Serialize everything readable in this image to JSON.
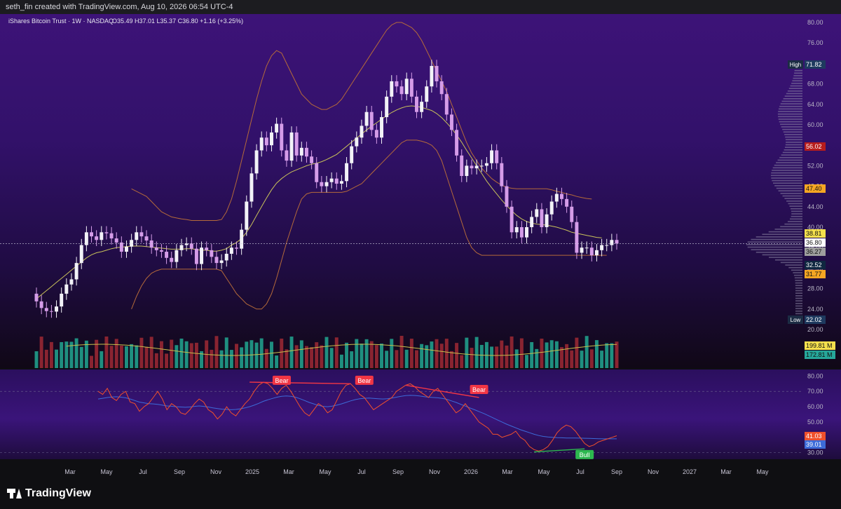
{
  "header": {
    "credit": "seth_fin created with TradingView.com, Aug 10, 2026 06:54 UTC-4"
  },
  "legend": {
    "symbol": "iShares Bitcoin Trust · 1W · NASDAQ",
    "ohlc": "O35.49  H37.01  L35.37  C36.80  +1.16 (+3.25%)"
  },
  "footer": {
    "brand": "TradingView"
  },
  "colors": {
    "bull_candle": "#f2f2f7",
    "bear_candle": "#d59ce8",
    "bb_band": "#b56a3a",
    "bb_basis": "#c9c25a",
    "vol_up": "#1f8f80",
    "vol_down": "#8a2431",
    "vol_ma": "#c8bf4c",
    "rsi_line": "#f0502c",
    "rsi_ma": "#3d6bd9",
    "bear_label": "#f23645",
    "bull_label": "#2db84f"
  },
  "chart_data": [
    {
      "type": "candlestick",
      "title": "iShares Bitcoin Trust · 1W · NASDAQ",
      "ylim": [
        20,
        82
      ],
      "y_ticks": [
        "80.00",
        "76.00",
        "72.00",
        "68.00",
        "64.00",
        "60.00",
        "56.00",
        "52.00",
        "48.00",
        "44.00",
        "40.00",
        "36.00",
        "32.00",
        "28.00",
        "24.00",
        "20.00"
      ],
      "x_ticks": [
        "Mar",
        "May",
        "Jul",
        "Sep",
        "Nov",
        "2025",
        "Mar",
        "May",
        "Jul",
        "Sep",
        "Nov",
        "2026",
        "Mar",
        "May",
        "Jul",
        "Sep",
        "Nov",
        "2027",
        "Mar",
        "May"
      ],
      "candle_closes": [
        25.5,
        24.2,
        23.6,
        23.5,
        24.5,
        27,
        28.8,
        29.8,
        33,
        36.5,
        39,
        38.2,
        37.5,
        39,
        38.8,
        37.8,
        37,
        35.2,
        36.2,
        37.5,
        39,
        38.2,
        37.4,
        36,
        35.5,
        35.2,
        34,
        33.2,
        35.5,
        36.5,
        36.8,
        35.8,
        32.8,
        36,
        35.5,
        34.2,
        33,
        33.5,
        34.8,
        36,
        35.8,
        39.5,
        45,
        50.5,
        55,
        57.5,
        56,
        58.5,
        60.2,
        55,
        53,
        58.5,
        54,
        55.5,
        53.8,
        52.5,
        48.8,
        48,
        48.8,
        49.5,
        48.5,
        49,
        52.5,
        55.8,
        57.5,
        59.8,
        62.5,
        59,
        57.5,
        61.5,
        65.5,
        68.5,
        67.5,
        66,
        69,
        65.5,
        62.5,
        64.5,
        67.5,
        71.5,
        68.5,
        66,
        62,
        59,
        54,
        50,
        52,
        51.5,
        52,
        52,
        52.5,
        55,
        52.5,
        48,
        44,
        39,
        40,
        38,
        40,
        42,
        43.5,
        40,
        42.5,
        45,
        46.5,
        45.5,
        44,
        41,
        35,
        36,
        36,
        34.5,
        35.5,
        36.5,
        36.5,
        37.5,
        36.8
      ],
      "bb_basis": [
        26,
        26.8,
        27.6,
        28.4,
        29.2,
        30,
        30.8,
        31.6,
        32.4,
        33.2,
        34,
        34.6,
        35,
        35.2,
        35.5,
        35.8,
        36,
        36.1,
        36.2,
        36.3,
        36.3,
        36.3,
        36.2,
        36.1,
        36,
        35.9,
        35.8,
        35.7,
        35.7,
        35.7,
        35.8,
        35.8,
        35.6,
        35.5,
        35.5,
        35.3,
        35.3,
        35.5,
        35.8,
        36.5,
        37,
        37.8,
        39,
        40.5,
        42.3,
        44,
        45.7,
        47.3,
        48.6,
        49.5,
        50.2,
        50.8,
        51.2,
        51.6,
        52,
        52.3,
        52.5,
        52.8,
        53.2,
        53.7,
        54.2,
        55,
        55.8,
        56.6,
        57.4,
        58.2,
        59,
        59.7,
        60.4,
        61.1,
        61.8,
        62.4,
        62.9,
        63.3,
        63.6,
        63.7,
        63.6,
        63.4,
        63.1,
        62.8,
        62.2,
        61.4,
        60.4,
        59.3,
        58,
        56.6,
        55,
        53.5,
        52,
        50.5,
        49,
        47.7,
        46.5,
        45.3,
        44.2,
        43.2,
        42.3,
        41.6,
        41.1,
        40.8,
        40.6,
        40.5,
        40.4,
        40.2,
        40,
        39.7,
        39.4,
        39,
        38.8,
        38.6,
        38.4,
        38.2,
        38,
        37.9
      ],
      "bb_upper": [
        0,
        0,
        0,
        0,
        0,
        0,
        0,
        0,
        0,
        0,
        0,
        0,
        0,
        0,
        0,
        0,
        0,
        0,
        0,
        47.5,
        47,
        46.5,
        46,
        45,
        44,
        43,
        42.5,
        42,
        41.8,
        41.6,
        41.5,
        41.3,
        41.3,
        41.3,
        41.3,
        41.3,
        41.3,
        41.5,
        43,
        45.5,
        49,
        53,
        57,
        61,
        65,
        68.5,
        71.5,
        73.5,
        74.5,
        74,
        72,
        70,
        68,
        66,
        65,
        64,
        63.5,
        63,
        63,
        63.5,
        64,
        65,
        66.5,
        68,
        69.5,
        71,
        72.5,
        74,
        75.5,
        77,
        78.5,
        79.5,
        80,
        80,
        79.5,
        79,
        78,
        76.5,
        74.5,
        72.5,
        70.5,
        68.5,
        66.5,
        64,
        61.5,
        59,
        56.5,
        54.5,
        53,
        51.5,
        50.5,
        49.5,
        48.8,
        48.2,
        47.8,
        47.6,
        47.5,
        47.5,
        47.5,
        47.5,
        47.5,
        47.5,
        47.5,
        47.3,
        47,
        46.8,
        46.5,
        46.3,
        46,
        45.8,
        45.6,
        45.5
      ],
      "bb_lower": [
        0,
        0,
        0,
        0,
        0,
        0,
        0,
        0,
        0,
        0,
        0,
        0,
        0,
        0,
        0,
        0,
        0,
        0,
        0,
        24,
        26.5,
        28.5,
        30,
        31,
        31.5,
        31.8,
        31.8,
        31.8,
        31.8,
        31.8,
        31.8,
        31.8,
        31.8,
        31.8,
        31.8,
        31.8,
        31.8,
        31.5,
        30,
        28.5,
        27,
        26,
        25,
        24.5,
        24,
        24,
        25,
        27,
        30,
        33.5,
        37,
        40,
        43,
        45.5,
        46.5,
        46.8,
        46.8,
        46.8,
        46.8,
        46.8,
        46.8,
        46.8,
        47,
        47.5,
        48,
        48.5,
        49.5,
        50.5,
        51.5,
        52.5,
        53.5,
        54.5,
        55.5,
        56.5,
        57,
        57,
        57,
        56.8,
        56.5,
        56,
        55,
        53,
        50,
        47,
        44,
        41,
        38,
        36,
        35,
        34.5,
        34.5,
        34.5,
        34.5,
        34.5,
        34.5,
        34.5,
        34.5,
        34.5,
        34.5,
        34.5,
        34.5,
        34.5,
        34.5,
        34.5,
        34.5,
        34.5,
        34.5,
        34.5,
        34.5,
        34.5,
        34.5,
        34.5,
        34.5,
        34.5,
        34.5
      ],
      "volume_trend": "volume bars, green up / red down, with yellow moving average",
      "axis_price_labels": [
        {
          "label": "High",
          "value": "71.82",
          "color": "#1e3a5f"
        },
        {
          "label": "",
          "value": "56.02",
          "color": "#b71c1c"
        },
        {
          "label": "",
          "value": "47.40",
          "color": "#f5a623"
        },
        {
          "label": "",
          "value": "38.81",
          "color": "#f4e04d"
        },
        {
          "label": "",
          "value": "36.80",
          "color": "#ffffff"
        },
        {
          "label": "",
          "value": "36.27",
          "color": "#9e9e9e"
        },
        {
          "label": "",
          "value": "32.52",
          "color": "#0f2740"
        },
        {
          "label": "",
          "value": "31.77",
          "color": "#f5a623"
        },
        {
          "label": "Low",
          "value": "22.02",
          "color": "#1e3a5f"
        },
        {
          "label": "",
          "value": "199.81 M",
          "color": "#f4e04d"
        },
        {
          "label": "",
          "value": "172.81 M",
          "color": "#26a69a"
        }
      ]
    },
    {
      "type": "line",
      "ylim": [
        28,
        82
      ],
      "y_ticks": [
        "80.00",
        "70.00",
        "60.00",
        "50.00",
        "30.00"
      ],
      "rsi": [
        70,
        68,
        72,
        66,
        64,
        68,
        70,
        63,
        62,
        57,
        60,
        62,
        66,
        70,
        65,
        58,
        62,
        60,
        56,
        55,
        58,
        62,
        65,
        63,
        58,
        56,
        52,
        55,
        60,
        56,
        54,
        58,
        62,
        65,
        70,
        74,
        76,
        75,
        72,
        68,
        72,
        74,
        70,
        65,
        60,
        56,
        54,
        58,
        62,
        60,
        56,
        58,
        64,
        70,
        74,
        75,
        72,
        68,
        66,
        62,
        58,
        60,
        62,
        64,
        66,
        70,
        72,
        74,
        75,
        73,
        70,
        68,
        66,
        70,
        72,
        68,
        64,
        60,
        56,
        58,
        62,
        58,
        54,
        50,
        48,
        46,
        42,
        42,
        40,
        41,
        42,
        44,
        40,
        38,
        34,
        32,
        31,
        32,
        34,
        38,
        43,
        46,
        48,
        47,
        44,
        40,
        36,
        34,
        35,
        37,
        38,
        39,
        40,
        41.03
      ],
      "rsi_ma": [
        65,
        65.5,
        66,
        66.3,
        66.5,
        66.2,
        65.8,
        65,
        64,
        63,
        62.5,
        62,
        61.8,
        61.5,
        61,
        60.5,
        60.3,
        60,
        59.8,
        59.6,
        59.8,
        60.2,
        60.5,
        60.2,
        59.8,
        59.2,
        58.8,
        58.4,
        58.2,
        58,
        58.2,
        58.6,
        59.2,
        60,
        61,
        62.2,
        63.5,
        64.5,
        65.4,
        66.2,
        66.8,
        67,
        66.8,
        66.2,
        65.2,
        64,
        62.8,
        61.8,
        60.8,
        60.2,
        60,
        60.4,
        61,
        61.8,
        62.8,
        63.8,
        64.6,
        65.2,
        65.5,
        65.6,
        65.4,
        65.2,
        65,
        65.2,
        65.6,
        66.2,
        66.8,
        67.2,
        67.4,
        67.3,
        67,
        66.6,
        66.2,
        66,
        65.8,
        65.4,
        64.8,
        63.8,
        62.8,
        61.6,
        60.4,
        59.2,
        58,
        56.8,
        55.6,
        54.2,
        52.8,
        51.4,
        50,
        48.6,
        47.4,
        46.2,
        45,
        44,
        43,
        42,
        41.2,
        40.6,
        40.2,
        40,
        39.8,
        39.7,
        39.6,
        39.6,
        39.6,
        39.5,
        39.4,
        39.3,
        39.2,
        39.1,
        39.05,
        39.02,
        39.01,
        39.01
      ],
      "axis_price_labels": [
        {
          "label": "",
          "value": "41.03",
          "color": "#f0502c"
        },
        {
          "label": "",
          "value": "39.01",
          "color": "#3d6bd9"
        }
      ],
      "annotations": [
        {
          "text": "Bear",
          "type": "bear"
        },
        {
          "text": "Bear",
          "type": "bear"
        },
        {
          "text": "Bear",
          "type": "bear"
        },
        {
          "text": "Bull",
          "type": "bull"
        }
      ]
    }
  ]
}
